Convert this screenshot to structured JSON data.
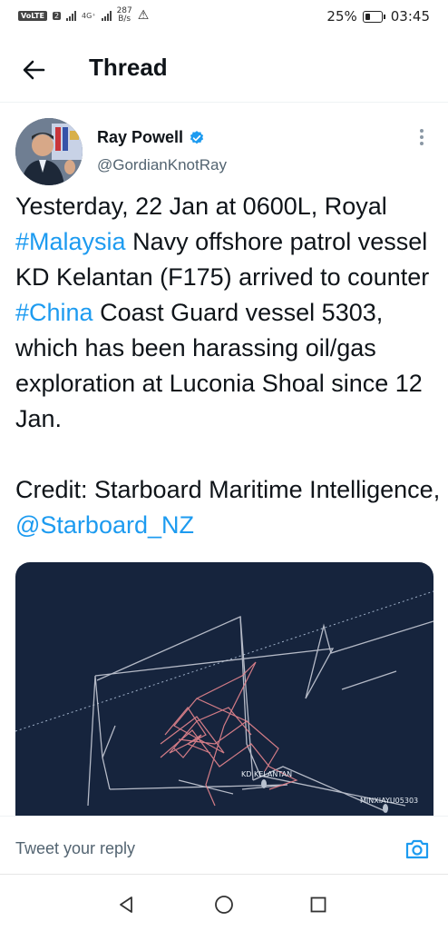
{
  "status_bar": {
    "volte": "VoLTE",
    "sim_slot": "2",
    "network_type": "4G⁺",
    "net_speed_value": "287",
    "net_speed_unit": "B/s",
    "battery_percent": "25%",
    "time": "03:45"
  },
  "header": {
    "title": "Thread",
    "back_icon": "arrow-left-icon"
  },
  "tweet": {
    "author_name": "Ray Powell",
    "author_handle": "@GordianKnotRay",
    "verified": true,
    "text": {
      "p1_a": "Yesterday, 22 Jan at 0600L, Royal ",
      "p1_hashtag1": "#Malaysia",
      "p1_b": " Navy offshore patrol vessel KD Kelantan (F175) arrived to counter ",
      "p1_hashtag2": "#China",
      "p1_c": " Coast Guard vessel 5303, which has been harassing oil/gas exploration at Luconia Shoal since 12 Jan.",
      "p2_a": "Credit: Starboard Maritime Intelligence, ",
      "p2_mention": "@Starboard_NZ"
    },
    "media": {
      "label_kd": "KD KELANTAN",
      "label_cg": "MINXIAYU05303"
    }
  },
  "reply_bar": {
    "placeholder": "Tweet your reply"
  },
  "colors": {
    "link": "#1d9bf0",
    "map_bg": "#16243d",
    "track_grey": "#c7cbd6",
    "track_red": "#e8868f"
  }
}
